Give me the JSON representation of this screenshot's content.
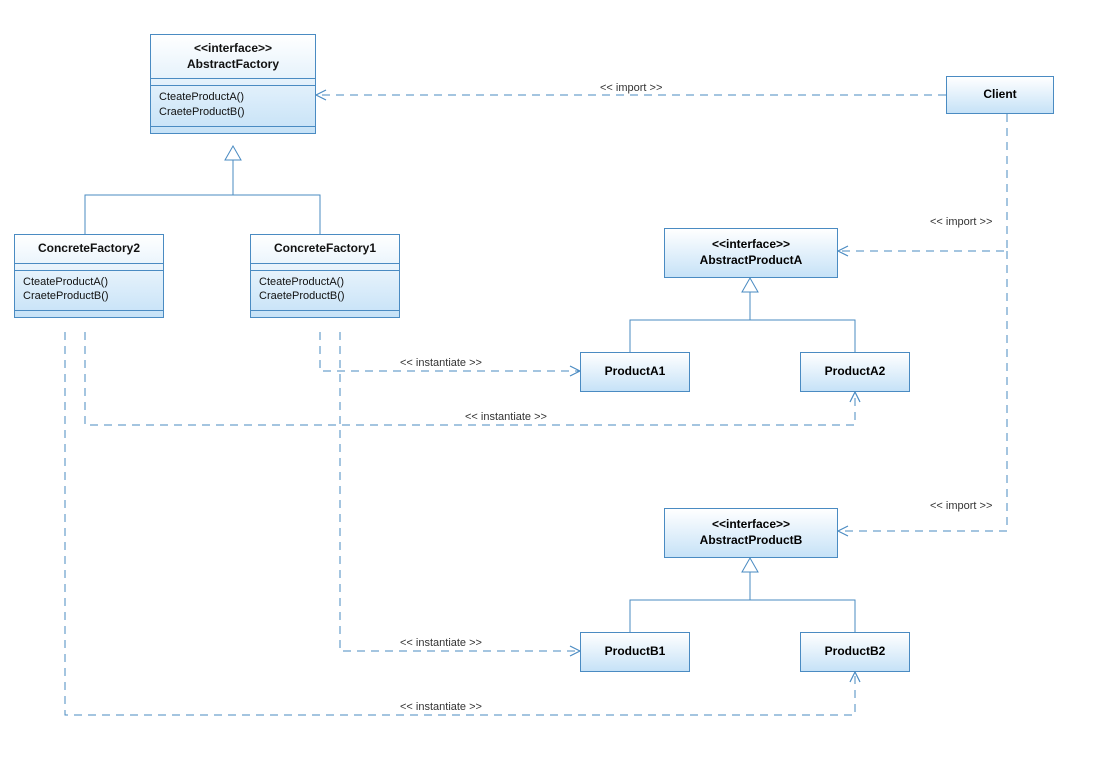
{
  "stereotypes": {
    "interface": "<<interface>>",
    "import": "<< import >>",
    "instantiate": "<< instantiate >>"
  },
  "classes": {
    "abstractFactory": {
      "name": "AbstractFactory",
      "ops": [
        "CteateProductA()",
        "CraeteProductB()"
      ]
    },
    "concreteFactory1": {
      "name": "ConcreteFactory1",
      "ops": [
        "CteateProductA()",
        "CraeteProductB()"
      ]
    },
    "concreteFactory2": {
      "name": "ConcreteFactory2",
      "ops": [
        "CteateProductA()",
        "CraeteProductB()"
      ]
    },
    "abstractProductA": {
      "name": "AbstractProductA"
    },
    "productA1": {
      "name": "ProductA1"
    },
    "productA2": {
      "name": "ProductA2"
    },
    "abstractProductB": {
      "name": "AbstractProductB"
    },
    "productB1": {
      "name": "ProductB1"
    },
    "productB2": {
      "name": "ProductB2"
    },
    "client": {
      "name": "Client"
    }
  }
}
